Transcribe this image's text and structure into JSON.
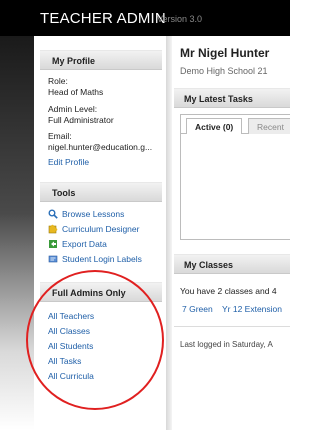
{
  "app": {
    "title": "TEACHER ADMIN",
    "version": "Version 3.0"
  },
  "profile": {
    "heading": "My Profile",
    "role_label": "Role:",
    "role_value": "Head of Maths",
    "admin_label": "Admin Level:",
    "admin_value": "Full Administrator",
    "email_label": "Email:",
    "email_value": "nigel.hunter@education.g...",
    "edit_link": "Edit Profile"
  },
  "tools": {
    "heading": "Tools",
    "items": [
      {
        "label": "Browse Lessons",
        "icon": "magnifier-icon"
      },
      {
        "label": "Curriculum Designer",
        "icon": "puzzle-icon"
      },
      {
        "label": "Export Data",
        "icon": "export-icon"
      },
      {
        "label": "Student Login Labels",
        "icon": "labels-icon"
      }
    ]
  },
  "full_admins": {
    "heading": "Full Admins Only",
    "links": [
      "All Teachers",
      "All Classes",
      "All Students",
      "All Tasks",
      "All Curricula"
    ]
  },
  "main": {
    "user_name": "Mr Nigel Hunter",
    "school": "Demo High School 21",
    "tasks_heading": "My Latest Tasks",
    "tabs": [
      {
        "label": "Active (0)",
        "active": true
      },
      {
        "label": "Recent",
        "active": false
      }
    ],
    "classes_heading": "My Classes",
    "classes_text": "You have 2 classes and 4",
    "class_links": [
      "7 Green",
      "Yr 12 Extension"
    ],
    "last_logged": "Last logged in Saturday, A"
  },
  "colors": {
    "accent_link": "#1f5fa8",
    "highlight_circle": "#e02020",
    "topbar": "#000000"
  }
}
